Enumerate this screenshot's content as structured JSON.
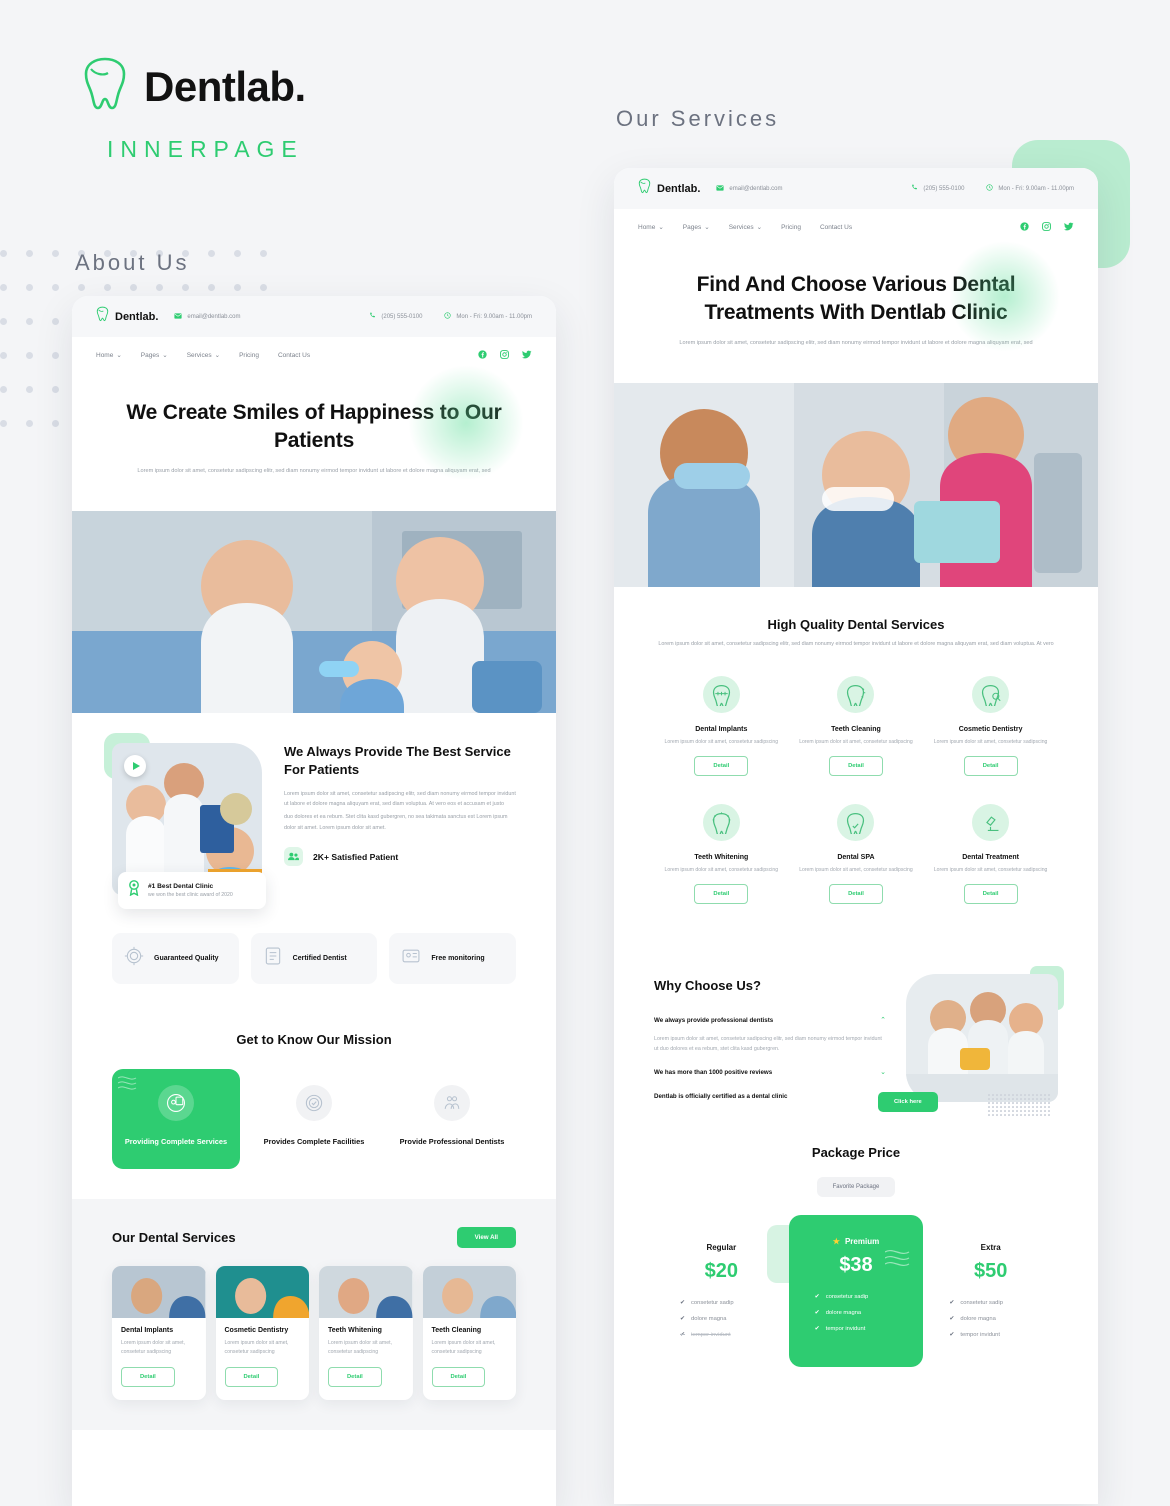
{
  "brand": {
    "name": "Dentlab.",
    "logo_icon": "tooth-icon",
    "subtitle": "INNERPAGE"
  },
  "labels": {
    "about": "About Us",
    "services": "Our Services"
  },
  "colors": {
    "accent": "#2ECC71",
    "accent_light": "#b9ecd0",
    "page_bg": "#f4f5f7",
    "star": "#FFD233"
  },
  "topbar": {
    "brand": "Dentlab.",
    "email": "email@dentlab.com",
    "email_icon": "mail-icon",
    "phone": "(205) 555-0100",
    "phone_icon": "phone-icon",
    "hours": "Mon - Fri: 9.00am - 11.00pm",
    "hours_icon": "clock-icon"
  },
  "nav": {
    "items": [
      {
        "label": "Home",
        "has_caret": true
      },
      {
        "label": "Pages",
        "has_caret": true
      },
      {
        "label": "Services",
        "has_caret": true
      },
      {
        "label": "Pricing",
        "has_caret": false
      },
      {
        "label": "Contact Us",
        "has_caret": false
      }
    ],
    "social": [
      "facebook-icon",
      "instagram-icon",
      "twitter-icon"
    ]
  },
  "about_page": {
    "hero": {
      "title": "We Create Smiles of Happiness to Our Patients",
      "subtitle": "Lorem ipsum dolor sit amet, consetetur sadipscing elitr, sed diam nonumy eirmod tempor invidunt ut labore et dolore magna aliquyam erat, sed"
    },
    "provide": {
      "title": "We Always Provide The Best Service For Patients",
      "body": "Lorem ipsum dolor sit amet, consetetur sadipscing elitr, sed diam nonumy eirmod tempor invidunt ut labore et dolore magna aliquyam erat, sed diam voluptua. At vero eos et accusam et justo",
      "body2": "duo dolores et ea rebum. Stet clita kasd gubergren, no sea takimata sanctus est Lorem ipsum dolor sit amet. Lorem ipsum dolor sit amet.",
      "award_title": "#1 Best Dental Clinic",
      "award_sub": "we won the best clinic award of 2020",
      "award_icon": "medal-icon",
      "satisfied": "2K+ Satisfied Patient",
      "satisfied_icon": "users-icon",
      "play_icon": "play-icon"
    },
    "badges": [
      {
        "title": "Guaranteed Quality",
        "icon": "quality-shield-icon"
      },
      {
        "title": "Certified Dentist",
        "icon": "certificate-icon"
      },
      {
        "title": "Free monitoring",
        "icon": "monitor-icon"
      }
    ],
    "mission": {
      "title": "Get to Know Our Mission",
      "cards": [
        {
          "title": "Providing Complete Services",
          "icon": "services-list-icon",
          "active": true
        },
        {
          "title": "Provides Complete Facilities",
          "icon": "check-badge-icon",
          "active": false
        },
        {
          "title": "Provide Professional Dentists",
          "icon": "dentists-icon",
          "active": false
        }
      ]
    },
    "dental_services": {
      "title": "Our Dental Services",
      "view_all": "View All",
      "cards": [
        {
          "title": "Dental Implants",
          "desc": "Lorem ipsum dolor sit amet, consetetur sadipscing",
          "button": "Detail"
        },
        {
          "title": "Cosmetic Dentistry",
          "desc": "Lorem ipsum dolor sit amet, consetetur sadipscing",
          "button": "Detail"
        },
        {
          "title": "Teeth Whitening",
          "desc": "Lorem ipsum dolor sit amet, consetetur sadipscing",
          "button": "Detail"
        },
        {
          "title": "Teeth Cleaning",
          "desc": "Lorem ipsum dolor sit amet, consetetur sadipscing",
          "button": "Detail"
        }
      ]
    }
  },
  "services_page": {
    "hero": {
      "title": "Find And Choose Various Dental Treatments With Dentlab Clinic",
      "subtitle": "Lorem ipsum dolor sit amet, consetetur sadipscing elitr, sed diam nonumy eirmod tempor invidunt ut labore et dolore magna aliquyam erat, sed"
    },
    "high_quality": {
      "title": "High Quality Dental Services",
      "subtitle": "Lorem ipsum dolor sit amet, consetetur sadipscing elitr, sed diam nonumy eirmod tempor invidunt ut labore et dolore magna aliquyam erat, sed diam voluptua. At vero",
      "items": [
        {
          "title": "Dental Implants",
          "desc": "Lorem ipsum dolor sit amet, consetetur sadipscing",
          "button": "Detail",
          "icon": "tooth-braces-icon"
        },
        {
          "title": "Teeth Cleaning",
          "desc": "Lorem ipsum dolor sit amet, consetetur sadipscing",
          "button": "Detail",
          "icon": "tooth-sparkle-icon"
        },
        {
          "title": "Cosmetic Dentistry",
          "desc": "Lorem ipsum dolor sit amet, consetetur sadipscing",
          "button": "Detail",
          "icon": "tooth-mirror-icon"
        },
        {
          "title": "Teeth Whitening",
          "desc": "Lorem ipsum dolor sit amet, consetetur sadipscing",
          "button": "Detail",
          "icon": "tooth-shine-icon"
        },
        {
          "title": "Dental SPA",
          "desc": "Lorem ipsum dolor sit amet, consetetur sadipscing",
          "button": "Detail",
          "icon": "tooth-check-icon"
        },
        {
          "title": "Dental Treatment",
          "desc": "Lorem ipsum dolor sit amet, consetetur sadipscing",
          "button": "Detail",
          "icon": "microscope-icon"
        }
      ]
    },
    "why_choose": {
      "title": "Why Choose Us?",
      "items": [
        {
          "q": "We always provide professional dentists",
          "a": "Lorem ipsum dolor sit amet, consetetur sadipscing elitr, sed diam nonumy eirmod tempor invidunt ut duo dolores et ea rebum, stet clita kasd gubergren.",
          "open": true
        },
        {
          "q": "We has more than 1000 positive reviews",
          "a": "",
          "open": false
        },
        {
          "q": "Dentlab is officially certified as a dental clinic",
          "a": "",
          "open": false
        }
      ],
      "button": "Click here"
    },
    "package": {
      "title": "Package Price",
      "favorite_pill": "Favorite Package",
      "plans": [
        {
          "name": "Regular",
          "price": "$20",
          "featured": false,
          "features": [
            {
              "text": "consetetur sadip",
              "enabled": true
            },
            {
              "text": "dolore magna",
              "enabled": true
            },
            {
              "text": "tempor invidunt",
              "enabled": false
            }
          ]
        },
        {
          "name": "Premium",
          "price": "$38",
          "featured": true,
          "star_icon": "star-icon",
          "features": [
            {
              "text": "consetetur sadip",
              "enabled": true
            },
            {
              "text": "dolore magna",
              "enabled": true
            },
            {
              "text": "tempor invidunt",
              "enabled": true
            }
          ]
        },
        {
          "name": "Extra",
          "price": "$50",
          "featured": false,
          "features": [
            {
              "text": "consetetur sadip",
              "enabled": true
            },
            {
              "text": "dolore magna",
              "enabled": true
            },
            {
              "text": "tempor invidunt",
              "enabled": true
            }
          ]
        }
      ]
    }
  }
}
